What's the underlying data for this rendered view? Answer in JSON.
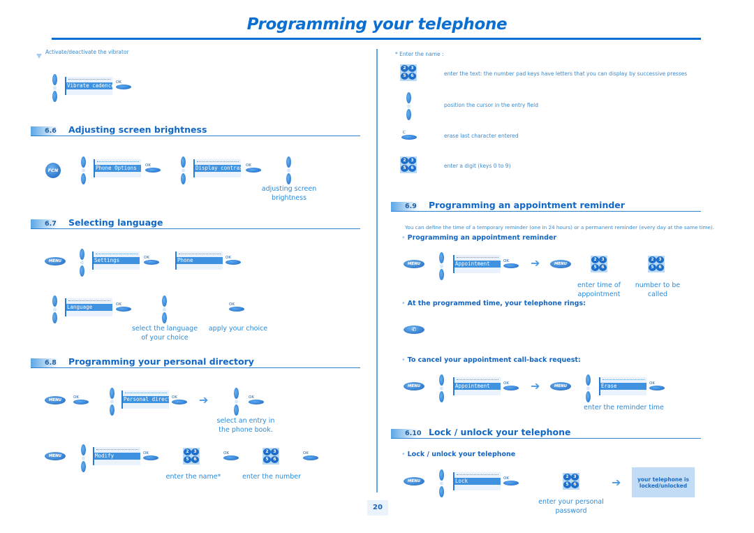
{
  "page": {
    "title": "Programming your telephone",
    "page_number": "20"
  },
  "intro": {
    "vibrator_note": "Activate/deactivate the vibrator",
    "vibrator_screen": "Vibrate cadence"
  },
  "keys": {
    "ok": "OK",
    "menu": "MENU",
    "fcn": "FCN",
    "c": "C",
    "phone_glyph": "✆",
    "arrow": "➔",
    "keypad": [
      "2",
      "3",
      "5",
      "6"
    ]
  },
  "sections": {
    "s66": {
      "number": "6.6",
      "title": "Adjusting screen brightness",
      "screens": [
        "Phone Options",
        "Display contrast"
      ],
      "caption": [
        "adjusting screen",
        "brightness"
      ]
    },
    "s67": {
      "number": "6.7",
      "title": "Selecting language",
      "screens": [
        "Settings",
        "Phone",
        "Language"
      ],
      "captions": {
        "select": [
          "select the language",
          "of your choice"
        ],
        "apply": "apply your choice"
      }
    },
    "s68": {
      "number": "6.8",
      "title": "Programming your personal directory",
      "screens": [
        "Personal directory",
        "Modify"
      ],
      "captions": {
        "select_entry": [
          "select an entry in",
          "the phone book."
        ],
        "enter_name": "enter the name*",
        "enter_number": "enter the number"
      }
    },
    "enter_name_help": {
      "heading": "* Enter the name :",
      "items": [
        "enter the text: the number pad keys have letters that you can display by successive presses",
        "position the cursor in the entry field",
        "erase last character entered",
        "enter a digit (keys 0 to 9)"
      ]
    },
    "s69": {
      "number": "6.9",
      "title": "Programming an appointment reminder",
      "description": "You can define the time of a temporary reminder (one in 24 hours) or a permanent reminder (every day at the same time).",
      "sub1": "Programming an appointment reminder",
      "screens": [
        "Appointment",
        "Erase"
      ],
      "captions": {
        "time": [
          "enter time of",
          "appointment"
        ],
        "number": [
          "number to be",
          "called"
        ],
        "reminder_time": "enter the reminder time"
      },
      "sub2": "At the programmed time, your telephone rings:",
      "sub3": "To cancel your appointment call-back request:"
    },
    "s610": {
      "number": "6.10",
      "title": "Lock / unlock your telephone",
      "sub1": "Lock / unlock your telephone",
      "screen": "Lock",
      "caption": [
        "enter your personal",
        "password"
      ],
      "result": [
        "your telephone is",
        "locked/unlocked"
      ]
    }
  }
}
